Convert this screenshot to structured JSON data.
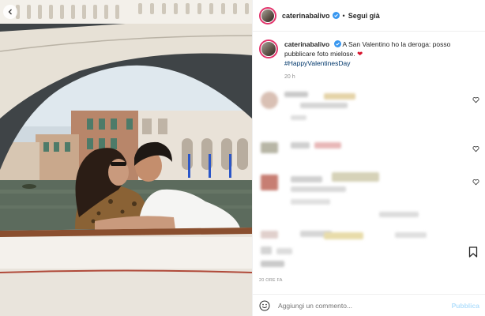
{
  "post": {
    "username": "caterinabalivo",
    "follow_label": "Segui già",
    "separator": "•",
    "caption_text": "A San Valentino ho la deroga: posso pubblicare foto mielose.",
    "caption_emoji": "❤",
    "hashtag": "#HappyValentinesDay",
    "posted_time": "20 h",
    "time_ago": "20 ORE FA"
  },
  "comment_box": {
    "placeholder": "Aggiungi un commento...",
    "publish_label": "Pubblica"
  },
  "icons": {
    "verified": "verified-badge-icon",
    "like": "heart-outline-icon",
    "save": "bookmark-icon",
    "emoji": "smiley-icon",
    "prev": "chevron-left-icon"
  },
  "colors": {
    "link": "#00376b",
    "publish": "#b2dffc",
    "verified": "#3897f0",
    "story_ring": "#e2336b"
  }
}
